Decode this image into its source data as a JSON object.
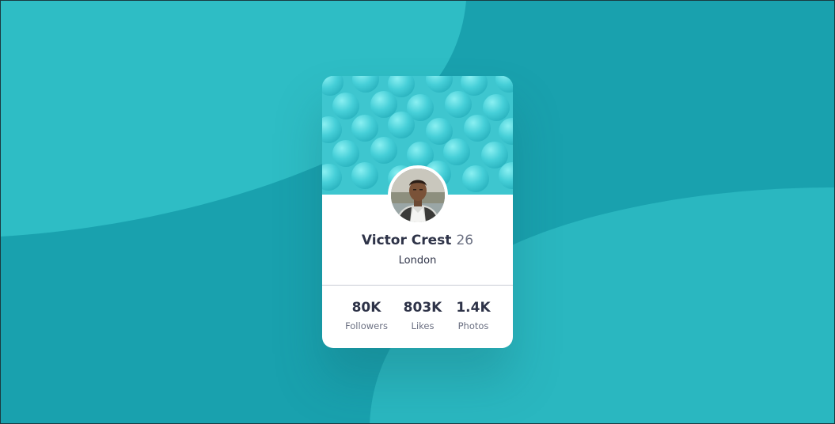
{
  "colors": {
    "background": "#19a1ae",
    "background_shape_light": "#2ebdc5",
    "card_header": "#4bd3db",
    "text_dark": "#2e3348",
    "text_muted": "#6b7082"
  },
  "profile": {
    "name": "Victor Crest",
    "age": "26",
    "city": "London",
    "avatar_icon": "person-photo"
  },
  "stats": [
    {
      "value": "80K",
      "label": "Followers"
    },
    {
      "value": "803K",
      "label": "Likes"
    },
    {
      "value": "1.4K",
      "label": "Photos"
    }
  ]
}
